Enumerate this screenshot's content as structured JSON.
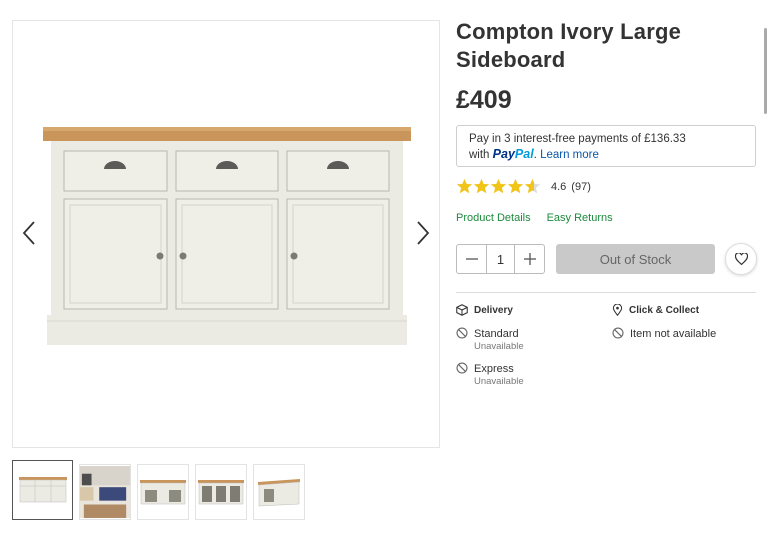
{
  "product": {
    "title": "Compton Ivory Large Sideboard",
    "price": "£409",
    "image_alt": "Compton Ivory Large Sideboard"
  },
  "paypal": {
    "line1": "Pay in 3 interest-free payments of £136.33",
    "with": "with",
    "logo_pay": "Pay",
    "logo_pal": "Pal",
    "learn_more": "Learn more"
  },
  "rating": {
    "value": "4.6",
    "count": "(97)",
    "stars_filled": 4.6,
    "star_color": "#f0c419"
  },
  "links": {
    "details": "Product Details",
    "returns": "Easy Returns"
  },
  "quantity": {
    "value": "1"
  },
  "stock_button": "Out of Stock",
  "delivery": {
    "heading": "Delivery",
    "options": [
      {
        "label": "Standard",
        "status": "Unavailable"
      },
      {
        "label": "Express",
        "status": "Unavailable"
      }
    ]
  },
  "collect": {
    "heading": "Click & Collect",
    "status": "Item not available"
  },
  "icons": {
    "prev": "chevron-left-icon",
    "next": "chevron-right-icon",
    "minus": "minus-icon",
    "plus": "plus-icon",
    "wishlist": "heart-icon",
    "delivery": "box-icon",
    "collect": "location-pin-icon",
    "unavailable": "blocked-icon"
  },
  "colors": {
    "accent_green": "#1c8a3c",
    "button_disabled": "#c9c9c9"
  }
}
